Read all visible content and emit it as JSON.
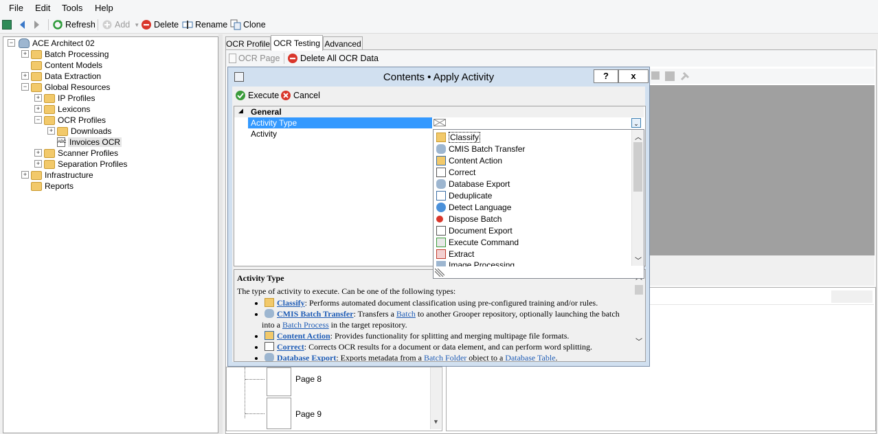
{
  "menu": [
    "File",
    "Edit",
    "Tools",
    "Help"
  ],
  "toolbar": {
    "refresh": "Refresh",
    "add": "Add",
    "delete": "Delete",
    "rename": "Rename",
    "clone": "Clone"
  },
  "tree": {
    "root": "ACE Architect 02",
    "items": [
      "Batch Processing",
      "Content Models",
      "Data Extraction",
      "Global Resources",
      "IP Profiles",
      "Lexicons",
      "OCR Profiles",
      "Downloads",
      "Invoices OCR",
      "Scanner Profiles",
      "Separation Profiles",
      "Infrastructure",
      "Reports"
    ]
  },
  "tabs": [
    "OCR Profile",
    "OCR Testing",
    "Advanced"
  ],
  "ocr_toolbar": {
    "ocr_page": "OCR Page",
    "delete_all": "Delete All OCR Data"
  },
  "dialog": {
    "title": "Contents • Apply Activity",
    "help_btn": "?",
    "close_btn": "x",
    "execute": "Execute",
    "cancel": "Cancel",
    "category": "General",
    "props": [
      "Activity Type",
      "Activity"
    ]
  },
  "dropdown": {
    "items": [
      "Classify",
      "CMIS Batch Transfer",
      "Content Action",
      "Correct",
      "Database Export",
      "Deduplicate",
      "Detect Language",
      "Dispose Batch",
      "Document Export",
      "Execute Command",
      "Extract",
      "Image Processing"
    ]
  },
  "help": {
    "title": "Activity Type",
    "intro": "The type of activity to execute. Can be one of the following types:",
    "entries": [
      {
        "name": "Classify",
        "text": ": Performs automated document classification using pre-configured training and/or rules."
      },
      {
        "name": "CMIS Batch Transfer",
        "t1": ": Transfers a ",
        "l1": "Batch",
        "t2": " to another Grooper repository, optionally launching the batch",
        "t3": "into a ",
        "l2": "Batch Process",
        "t4": " in the target repository."
      },
      {
        "name": "Content Action",
        "text": ": Provides functionality for splitting and merging multipage file formats."
      },
      {
        "name": "Correct",
        "text": ": Corrects OCR results for a document or data element, and can perform word splitting."
      },
      {
        "name": "Database Export",
        "t1": ": Exports metadata from a ",
        "l1": "Batch Folder",
        "t2": " object to a ",
        "l2": "Database Table",
        "t3": "."
      }
    ]
  },
  "pages": [
    "Page 8",
    "Page 9"
  ]
}
